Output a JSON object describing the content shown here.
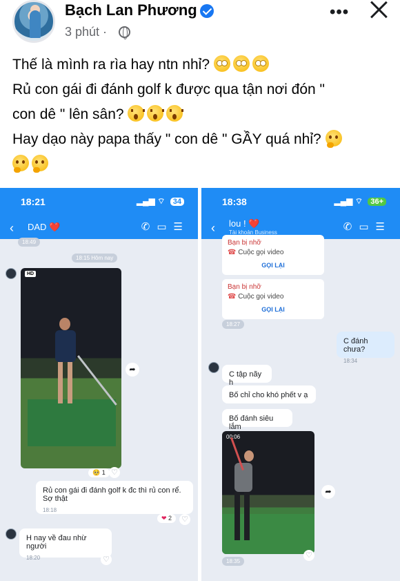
{
  "post": {
    "author": "Bạch Lan Phương",
    "time": "3 phút ·",
    "lines": {
      "l1": "Thế là mình ra rìa hay ntn nhỉ?",
      "l2": "Rủ con gái đi đánh golf k được qua tận nơi đón \"",
      "l3": "con dê \" lên sân?",
      "l4": "Hay dạo này papa thấy \" con dê \" GẦY quá nhỉ?"
    }
  },
  "left_chat": {
    "status_time": "18:21",
    "battery": "34",
    "contact": "DAD ❤️",
    "top_chip": "18:49",
    "date_chip": "18:15 Hôm nay",
    "hd": "HD",
    "reaction_count": "1",
    "message1": {
      "line1": "Rủ con gái đi đánh golf k đc thì rủ con rể.",
      "line2": "Sợ thật",
      "time": "18:18",
      "reaction": "2"
    },
    "message2": {
      "text": "H nay về đau nhừ người",
      "time": "18:20"
    }
  },
  "right_chat": {
    "status_time": "18:38",
    "battery": "36+",
    "contact": "lou ! ❤️",
    "contact_sub": "Tài khoản Business",
    "missed": [
      {
        "title": "Bạn bị nhỡ",
        "line": "Cuộc gọi video",
        "action": "GỌI LẠI"
      },
      {
        "title": "Bạn bị nhỡ",
        "line": "Cuộc gọi video",
        "action": "GỌI LẠI"
      }
    ],
    "chip_after_missed": "18:27",
    "mine": {
      "text": "C đánh chưa?",
      "time": "18:34"
    },
    "replies": [
      "C tập nãy h",
      "Bố chỉ cho khó phết v ạ",
      "Bố đánh siêu lắm"
    ],
    "video_duration": "00:06",
    "bottom_chip": "18:35"
  }
}
